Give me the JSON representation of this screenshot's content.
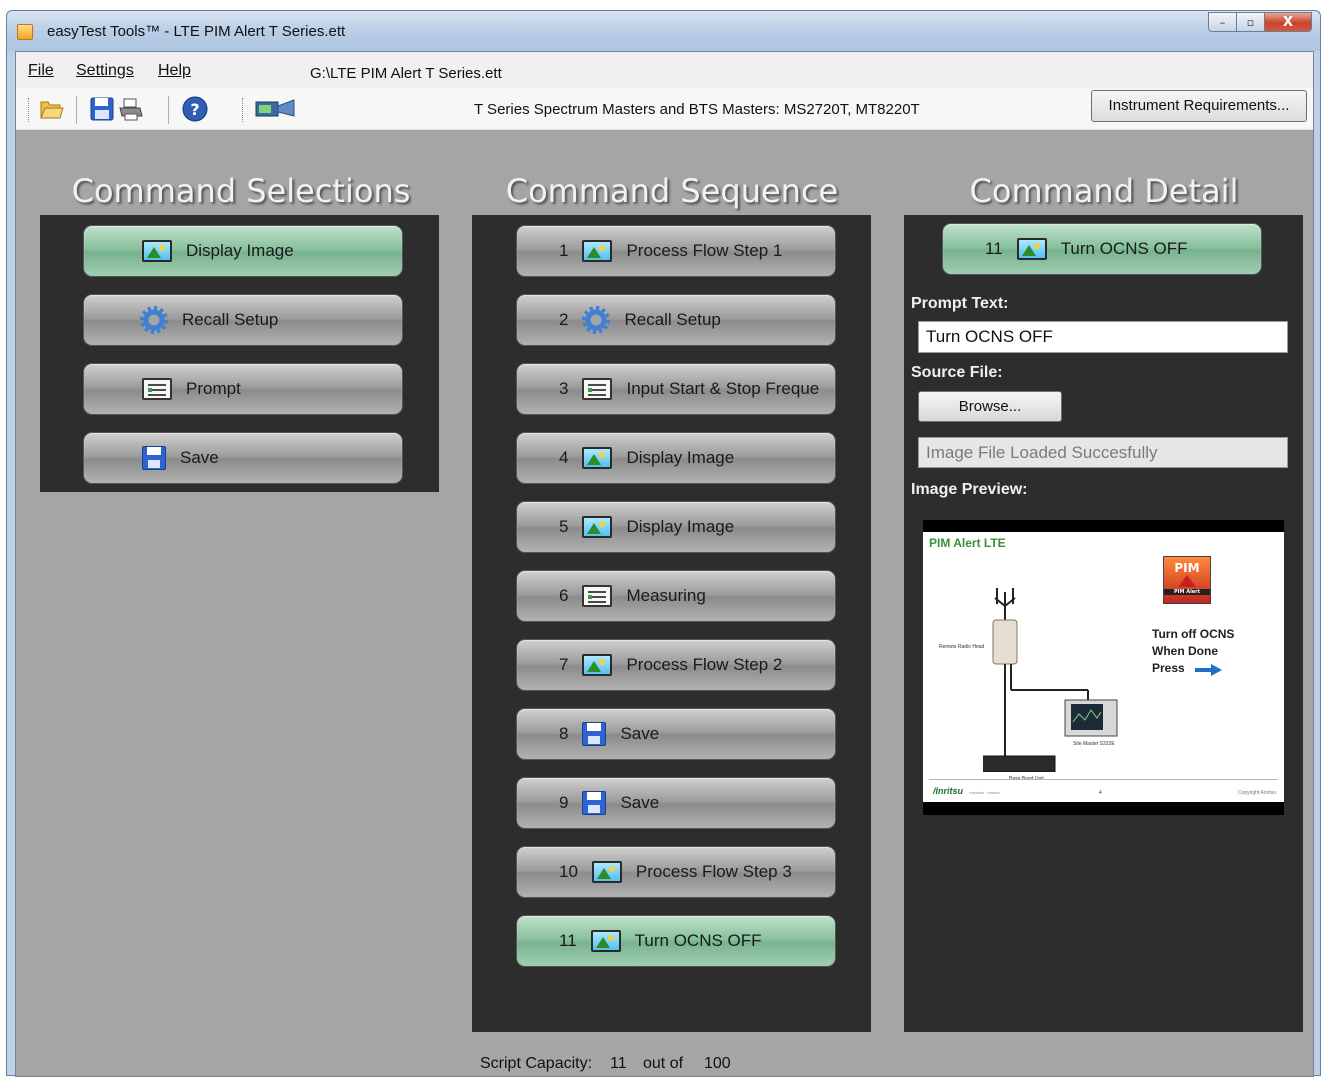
{
  "window": {
    "title": "easyTest Tools™  - LTE PIM Alert T Series.ett",
    "controls": {
      "minimize": "–",
      "maximize": "▫",
      "close": "X"
    }
  },
  "menu": {
    "file": "File",
    "settings": "Settings",
    "help": "Help",
    "file_path": "G:\\LTE PIM Alert T Series.ett"
  },
  "toolbar": {
    "icons": [
      "open-folder-icon",
      "save-icon",
      "print-icon",
      "help-icon",
      "instrument-connect-icon"
    ],
    "instrument_info": "T Series Spectrum Masters and BTS Masters: MS2720T, MT8220T",
    "requirements_button": "Instrument Requirements..."
  },
  "columns": {
    "selections_title": "Command Selections",
    "sequence_title": "Command Sequence",
    "detail_title": "Command Detail"
  },
  "command_selections": [
    {
      "label": "Display Image",
      "icon": "image-icon",
      "selected": true
    },
    {
      "label": "Recall Setup",
      "icon": "gear-icon",
      "selected": false
    },
    {
      "label": "Prompt",
      "icon": "prompt-icon",
      "selected": false
    },
    {
      "label": "Save",
      "icon": "save-icon",
      "selected": false
    }
  ],
  "command_sequence": [
    {
      "num": "1",
      "label": "Process Flow Step 1",
      "icon": "image-icon",
      "selected": false
    },
    {
      "num": "2",
      "label": "Recall Setup",
      "icon": "gear-icon",
      "selected": false
    },
    {
      "num": "3",
      "label": "Input Start & Stop Freque",
      "icon": "prompt-icon",
      "selected": false
    },
    {
      "num": "4",
      "label": "Display Image",
      "icon": "image-icon",
      "selected": false
    },
    {
      "num": "5",
      "label": "Display Image",
      "icon": "image-icon",
      "selected": false
    },
    {
      "num": "6",
      "label": "Measuring",
      "icon": "prompt-icon",
      "selected": false
    },
    {
      "num": "7",
      "label": "Process Flow Step 2",
      "icon": "image-icon",
      "selected": false
    },
    {
      "num": "8",
      "label": "Save",
      "icon": "save-icon",
      "selected": false
    },
    {
      "num": "9",
      "label": "Save",
      "icon": "save-icon",
      "selected": false
    },
    {
      "num": "10",
      "label": "Process Flow Step 3",
      "icon": "image-icon",
      "selected": false
    },
    {
      "num": "11",
      "label": "Turn OCNS OFF",
      "icon": "image-icon",
      "selected": true
    }
  ],
  "command_detail": {
    "header_num": "11",
    "header_label": "Turn OCNS OFF",
    "prompt_text_label": "Prompt Text:",
    "prompt_text_value": "Turn OCNS OFF",
    "source_file_label": "Source File:",
    "browse_button": "Browse...",
    "status_text": "Image File Loaded Succesfully",
    "image_preview_label": "Image Preview:",
    "preview": {
      "title": "PIM Alert LTE",
      "logo_text": "PIM",
      "logo_subtext": "PIM Alert",
      "instruction_line1": "Turn off OCNS",
      "instruction_line2": "When Done",
      "instruction_line3": "Press",
      "remote_radio_label": "Remote Radio Head",
      "site_master_label": "Site Master S332E",
      "base_band_label": "Base Band Unit",
      "brand": "/Inritsu",
      "brand_tagline": "envision : ensure",
      "page_number": "4",
      "copyright": "Copyright Anritsu"
    }
  },
  "status": {
    "capacity_label": "Script Capacity:",
    "capacity_used": "11",
    "capacity_out_of": "out of",
    "capacity_max": "100"
  }
}
